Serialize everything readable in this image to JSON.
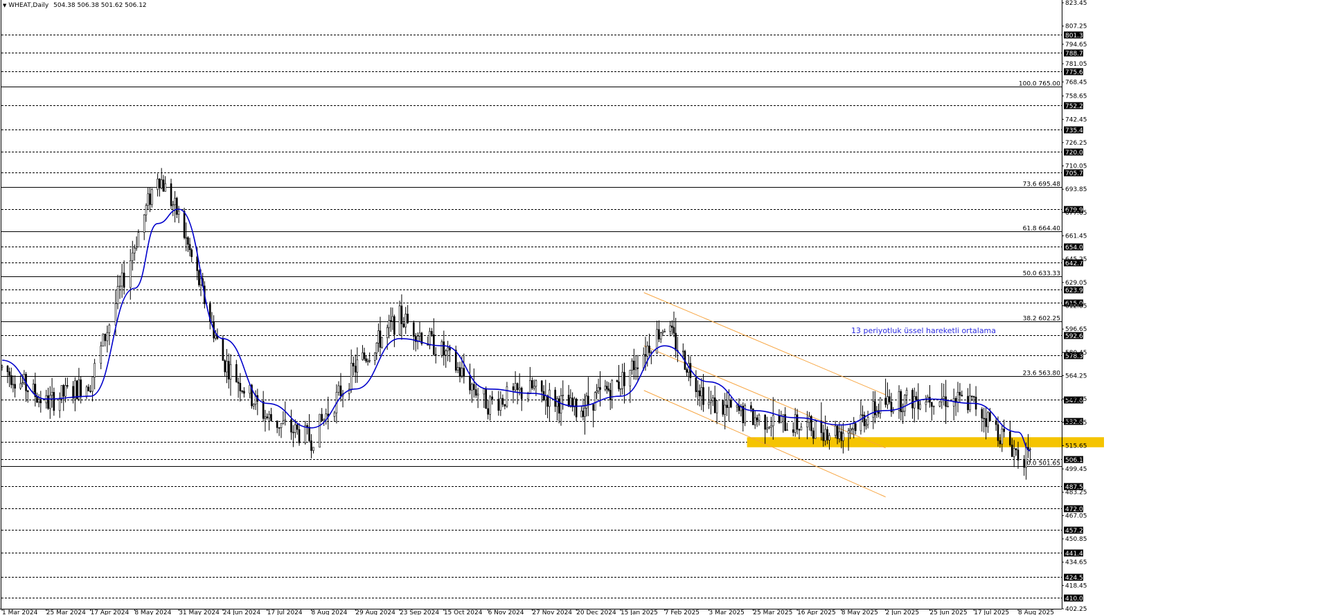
{
  "header": {
    "symbol": "WHEAT,Daily",
    "ohlc": "504.38 506.38 501.62 506.12"
  },
  "chart_data": {
    "type": "candlestick",
    "title": "WHEAT,Daily",
    "ylim": [
      402.25,
      823.45
    ],
    "x_ticks": [
      "1 Mar 2024",
      "25 Mar 2024",
      "17 Apr 2024",
      "8 May 2024",
      "31 May 2024",
      "24 Jun 2024",
      "17 Jul 2024",
      "8 Aug 2024",
      "29 Aug 2024",
      "23 Sep 2024",
      "15 Oct 2024",
      "6 Nov 2024",
      "27 Nov 2024",
      "20 Dec 2024",
      "15 Jan 2025",
      "7 Feb 2025",
      "3 Mar 2025",
      "25 Mar 2025",
      "16 Apr 2025",
      "8 May 2025",
      "2 Jun 2025",
      "25 Jun 2025",
      "17 Jul 2025",
      "8 Aug 2025"
    ],
    "y_ticks": [
      "823.45",
      "807.25",
      "794.65",
      "781.05",
      "768.45",
      "758.65",
      "742.45",
      "726.25",
      "710.05",
      "693.85",
      "677.65",
      "661.45",
      "645.25",
      "629.05",
      "612.85",
      "596.65",
      "580.45",
      "564.25",
      "548.05",
      "531.85",
      "515.65",
      "499.45",
      "483.25",
      "467.05",
      "450.85",
      "434.65",
      "418.45",
      "402.25"
    ],
    "price_levels": [
      {
        "label": "801.30",
        "value": 801.3
      },
      {
        "label": "788.75",
        "value": 788.75
      },
      {
        "label": "775.65",
        "value": 775.65
      },
      {
        "label": "752.20",
        "value": 752.2
      },
      {
        "label": "735.45",
        "value": 735.45
      },
      {
        "label": "720.05",
        "value": 720.05
      },
      {
        "label": "705.70",
        "value": 705.7
      },
      {
        "label": "679.99",
        "value": 679.99
      },
      {
        "label": "654.05",
        "value": 654.05
      },
      {
        "label": "642.75",
        "value": 642.75
      },
      {
        "label": "623.95",
        "value": 623.95
      },
      {
        "label": "615.05",
        "value": 615.05
      },
      {
        "label": "592.60",
        "value": 592.6
      },
      {
        "label": "578.30",
        "value": 578.3
      },
      {
        "label": "547.65",
        "value": 547.65
      },
      {
        "label": "532.65",
        "value": 532.65
      },
      {
        "label": "518.20",
        "value": 518.2
      },
      {
        "label": "506.12",
        "value": 506.12
      },
      {
        "label": "487.50",
        "value": 487.5
      },
      {
        "label": "472.05",
        "value": 472.05
      },
      {
        "label": "457.25",
        "value": 457.25
      },
      {
        "label": "441.40",
        "value": 441.4
      },
      {
        "label": "424.50",
        "value": 424.5
      },
      {
        "label": "410.00",
        "value": 410.0
      }
    ],
    "fibonacci": [
      {
        "label": "100.0 765.00",
        "value": 765.0
      },
      {
        "label": "73.6 695.48",
        "value": 695.48
      },
      {
        "label": "61.8 664.40",
        "value": 664.4
      },
      {
        "label": "50.0 633.33",
        "value": 633.33
      },
      {
        "label": "38.2 602.25",
        "value": 602.25
      },
      {
        "label": "23.6 563.80",
        "value": 563.8
      },
      {
        "label": "0.0 501.65",
        "value": 501.65
      }
    ],
    "support_zone": {
      "low": 514.5,
      "high": 521.5,
      "color": "#f5c400"
    },
    "channel": {
      "color": "#f7a541",
      "upper": [
        [
          "7 Feb 2025",
          622
        ],
        [
          "2 Jun 2025",
          551
        ]
      ],
      "middle": [
        [
          "7 Feb 2025",
          585
        ],
        [
          "2 Jun 2025",
          514
        ]
      ],
      "lower": [
        [
          "7 Feb 2025",
          554
        ],
        [
          "2 Jun 2025",
          480
        ]
      ]
    },
    "ema_annotation": "13 periyotluk üssel hareketli ortalama",
    "ema_color": "#0000cc",
    "price_series": {
      "x": [
        "1 Mar 2024",
        "25 Mar 2024",
        "17 Apr 2024",
        "8 May 2024",
        "20 May 2024",
        "31 May 2024",
        "24 Jun 2024",
        "17 Jul 2024",
        "8 Aug 2024",
        "29 Aug 2024",
        "23 Sep 2024",
        "15 Oct 2024",
        "6 Nov 2024",
        "27 Nov 2024",
        "20 Dec 2024",
        "15 Jan 2025",
        "7 Feb 2025",
        "3 Mar 2025",
        "25 Mar 2025",
        "16 Apr 2025",
        "8 May 2025",
        "2 Jun 2025",
        "25 Jun 2025",
        "17 Jul 2025",
        "8 Aug 2025",
        "14 Aug 2025"
      ],
      "close": [
        570,
        545,
        560,
        655,
        705,
        675,
        575,
        535,
        520,
        570,
        605,
        580,
        545,
        555,
        540,
        560,
        600,
        545,
        535,
        530,
        525,
        545,
        550,
        545,
        510,
        506
      ]
    },
    "ema_series": {
      "x": [
        "1 Mar 2024",
        "25 Mar 2024",
        "17 Apr 2024",
        "8 May 2024",
        "20 May 2024",
        "31 May 2024",
        "24 Jun 2024",
        "17 Jul 2024",
        "8 Aug 2024",
        "29 Aug 2024",
        "23 Sep 2024",
        "15 Oct 2024",
        "6 Nov 2024",
        "27 Nov 2024",
        "20 Dec 2024",
        "15 Jan 2025",
        "7 Feb 2025",
        "3 Mar 2025",
        "25 Mar 2025",
        "16 Apr 2025",
        "8 May 2025",
        "2 Jun 2025",
        "25 Jun 2025",
        "17 Jul 2025",
        "8 Aug 2025",
        "14 Aug 2025"
      ],
      "values": [
        575,
        548,
        550,
        625,
        670,
        680,
        590,
        545,
        528,
        555,
        590,
        585,
        555,
        552,
        543,
        550,
        585,
        560,
        540,
        535,
        530,
        540,
        548,
        545,
        525,
        512
      ]
    }
  }
}
